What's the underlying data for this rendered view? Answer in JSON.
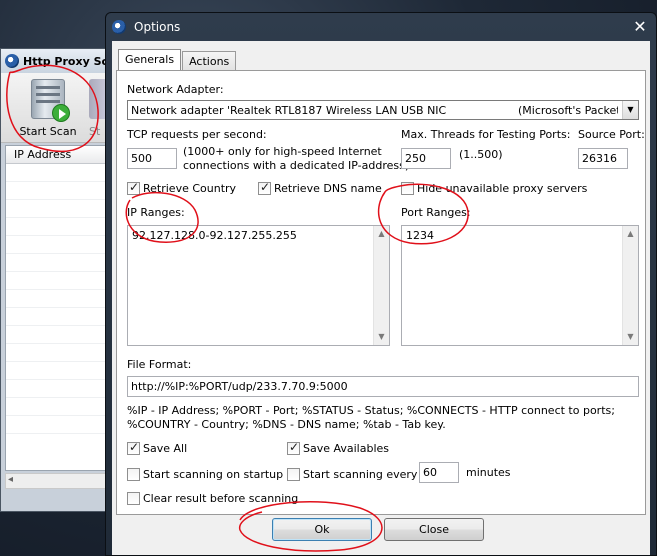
{
  "background_window": {
    "title": "Http Proxy Scan",
    "toolbar": {
      "start_label": "Start Scan",
      "stop_label": "St"
    },
    "list_header": "IP Address"
  },
  "dialog": {
    "title": "Options",
    "tabs": [
      {
        "label": "Generals",
        "active": true
      },
      {
        "label": "Actions",
        "active": false
      }
    ],
    "network_adapter": {
      "label": "Network Adapter:",
      "value_left": "Network adapter 'Realtek RTL8187 Wireless LAN USB NIC",
      "value_right": "(Microsoft's Packet Sc"
    },
    "tcp_requests": {
      "label": "TCP requests per second:",
      "value": "500",
      "hint_line1": "(1000+ only for high-speed Internet",
      "hint_line2": "connections with a dedicated IP-address)"
    },
    "max_threads": {
      "label": "Max. Threads for Testing Ports:",
      "value": "250",
      "range": "(1..500)"
    },
    "source_port": {
      "label": "Source Port:",
      "value": "26316"
    },
    "checkboxes_row1": {
      "retrieve_country": {
        "label": "Retrieve Country",
        "checked": true
      },
      "retrieve_dns": {
        "label": "Retrieve DNS name",
        "checked": true
      },
      "hide_unavailable": {
        "label": "Hide unavailable proxy servers",
        "checked": false
      }
    },
    "ip_ranges": {
      "label": "IP Ranges:",
      "value": "92.127.128.0-92.127.255.255"
    },
    "port_ranges": {
      "label": "Port Ranges:",
      "value": "1234"
    },
    "file_format": {
      "label": "File Format:",
      "value": "http://%IP:%PORT/udp/233.7.70.9:5000"
    },
    "format_help": {
      "line1": "%IP - IP Address; %PORT - Port; %STATUS - Status; %CONNECTS - HTTP connect to ports;",
      "line2": "%COUNTRY - Country; %DNS - DNS name; %tab - Tab key."
    },
    "save_all": {
      "label": "Save All",
      "checked": true
    },
    "save_availables": {
      "label": "Save Availables",
      "checked": true
    },
    "start_on_startup": {
      "label": "Start scanning on startup",
      "checked": false
    },
    "start_every": {
      "label": "Start scanning every",
      "checked": false,
      "value": "60",
      "unit": "minutes"
    },
    "clear_result": {
      "label": "Clear result before scanning",
      "checked": false
    },
    "ok_label": "Ok",
    "close_label": "Close"
  },
  "colors": {
    "annotation_red": "#e0101a",
    "dialog_frame": "#1f2a37",
    "default_button_border": "#3c7fb1"
  }
}
